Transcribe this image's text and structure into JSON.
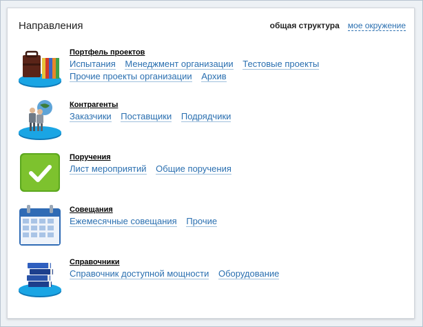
{
  "header": {
    "title": "Направления",
    "view_active": "общая структура",
    "view_link": "мое окружение"
  },
  "sections": [
    {
      "title": "Портфель проектов",
      "icon": "briefcase-folders-icon",
      "links": [
        "Испытания",
        "Менеджмент организации",
        "Тестовые проекты",
        "Прочие проекты организации",
        "Архив"
      ]
    },
    {
      "title": "Контрагенты",
      "icon": "people-globe-icon",
      "links": [
        "Заказчики",
        "Поставщики",
        "Подрядчики"
      ]
    },
    {
      "title": "Поручения",
      "icon": "checkmark-icon",
      "links": [
        "Лист мероприятий",
        "Общие поручения"
      ]
    },
    {
      "title": "Совещания",
      "icon": "calendar-icon",
      "links": [
        "Ежемесячные совещания",
        "Прочие"
      ]
    },
    {
      "title": "Справочники",
      "icon": "books-stack-icon",
      "links": [
        "Справочник доступной мощности",
        "Оборудование"
      ]
    }
  ],
  "colors": {
    "link": "#2a6fb0",
    "check_green": "#7dc22e",
    "calendar_blue": "#3a79c4",
    "platform_blue": "#1597d6"
  }
}
